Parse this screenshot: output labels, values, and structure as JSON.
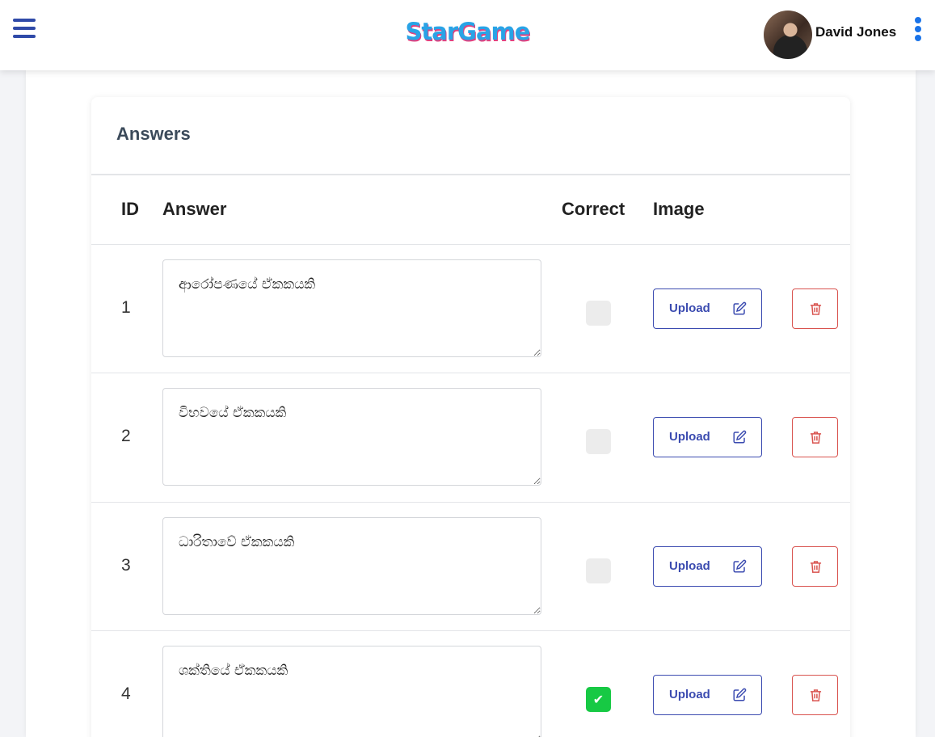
{
  "header": {
    "brand": "StarGame",
    "user_name": "David Jones"
  },
  "card": {
    "title": "Answers",
    "columns": {
      "id": "ID",
      "answer": "Answer",
      "correct": "Correct",
      "image": "Image"
    }
  },
  "rows": [
    {
      "id": "1",
      "answer": "ආරෝපණයේ ඒකකයකි",
      "correct": false,
      "upload_label": "Upload"
    },
    {
      "id": "2",
      "answer": "විභවයේ ඒකකයකි",
      "correct": false,
      "upload_label": "Upload"
    },
    {
      "id": "3",
      "answer": "ධාරිතාවේ ඒකකයකි",
      "correct": false,
      "upload_label": "Upload"
    },
    {
      "id": "4",
      "answer": "ශක්තියේ ඒකකයකි",
      "correct": true,
      "upload_label": "Upload"
    }
  ],
  "icons": {
    "menu": "hamburger-icon",
    "more": "kebab-vertical-icon",
    "upload": "edit-pencil-icon",
    "delete": "trash-icon",
    "check": "checkmark-icon"
  },
  "colors": {
    "primary": "#3b4bb0",
    "brand": "#29a3e6",
    "danger": "#d9534f",
    "success": "#17c944",
    "kebab": "#1a73e8"
  }
}
